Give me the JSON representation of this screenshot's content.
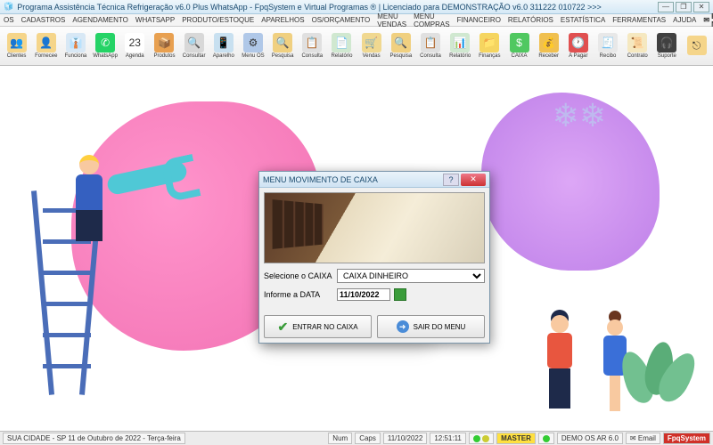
{
  "window": {
    "title": "Programa Assistência Técnica Refrigeração v6.0 Plus WhatsApp - FpqSystem e Virtual Programas ® | Licenciado para  DEMONSTRAÇÃO v6.0 311222 010722 >>>"
  },
  "menu": {
    "items": [
      "OS",
      "CADASTROS",
      "AGENDAMENTO",
      "WHATSAPP",
      "PRODUTO/ESTOQUE",
      "APARELHOS",
      "OS/ORÇAMENTO",
      "MENU VENDAS",
      "MENU COMPRAS",
      "FINANCEIRO",
      "RELATÓRIOS",
      "ESTATÍSTICA",
      "FERRAMENTAS",
      "AJUDA"
    ],
    "email": "E-MAIL"
  },
  "toolbar": {
    "buttons": [
      {
        "label": "Clientes",
        "icon": "👥",
        "bg": "#f5d58a"
      },
      {
        "label": "Fornecee",
        "icon": "👤",
        "bg": "#f5d58a"
      },
      {
        "label": "Funciona",
        "icon": "👔",
        "bg": "#d8e8f5"
      },
      {
        "label": "WhatsApp",
        "icon": "✆",
        "bg": "#25d366"
      },
      {
        "label": "Agenda",
        "icon": "23",
        "bg": "#fff"
      },
      {
        "label": "Produtos",
        "icon": "📦",
        "bg": "#e8a050"
      },
      {
        "label": "Consultar",
        "icon": "🔍",
        "bg": "#d8d8d8"
      },
      {
        "label": "Aparelho",
        "icon": "📱",
        "bg": "#c8e0f0"
      },
      {
        "label": "Menu OS",
        "icon": "⚙",
        "bg": "#b0c8e8"
      },
      {
        "label": "Pesquisa",
        "icon": "🔍",
        "bg": "#f0d080"
      },
      {
        "label": "Consulta",
        "icon": "📋",
        "bg": "#e0e0e0"
      },
      {
        "label": "Relatório",
        "icon": "📄",
        "bg": "#d0e8d0"
      },
      {
        "label": "Vendas",
        "icon": "🛒",
        "bg": "#f0d890"
      },
      {
        "label": "Pesquisa",
        "icon": "🔍",
        "bg": "#f0d080"
      },
      {
        "label": "Consulta",
        "icon": "📋",
        "bg": "#e0e0e0"
      },
      {
        "label": "Relatório",
        "icon": "📊",
        "bg": "#d0e8d0"
      },
      {
        "label": "Finanças",
        "icon": "📁",
        "bg": "#f5d560"
      },
      {
        "label": "CAIXA",
        "icon": "$",
        "bg": "#50c860"
      },
      {
        "label": "Receber",
        "icon": "💰",
        "bg": "#f0c050"
      },
      {
        "label": "A Pagar",
        "icon": "🕐",
        "bg": "#e05050"
      },
      {
        "label": "Recibo",
        "icon": "🧾",
        "bg": "#e8e8e8"
      },
      {
        "label": "Contrato",
        "icon": "📜",
        "bg": "#f5e8c0"
      },
      {
        "label": "Suporte",
        "icon": "🎧",
        "bg": "#404040"
      },
      {
        "label": "",
        "icon": "⎋",
        "bg": "#f5d58a"
      }
    ]
  },
  "dialog": {
    "title": "MENU MOVIMENTO DE CAIXA",
    "select_label": "Selecione o CAIXA",
    "select_value": "CAIXA DINHEIRO",
    "date_label": "Informe a DATA",
    "date_value": "11/10/2022",
    "btn_enter": "ENTRAR NO CAIXA",
    "btn_exit": "SAIR DO MENU"
  },
  "status": {
    "location": "SUA CIDADE - SP 11 de Outubro de 2022 - Terça-feira",
    "num": "Num",
    "caps": "Caps",
    "date": "11/10/2022",
    "time": "12:51:11",
    "master": "MASTER",
    "demo": "DEMO OS AR 6.0",
    "email": "Email",
    "brand": "FpqSystem"
  }
}
